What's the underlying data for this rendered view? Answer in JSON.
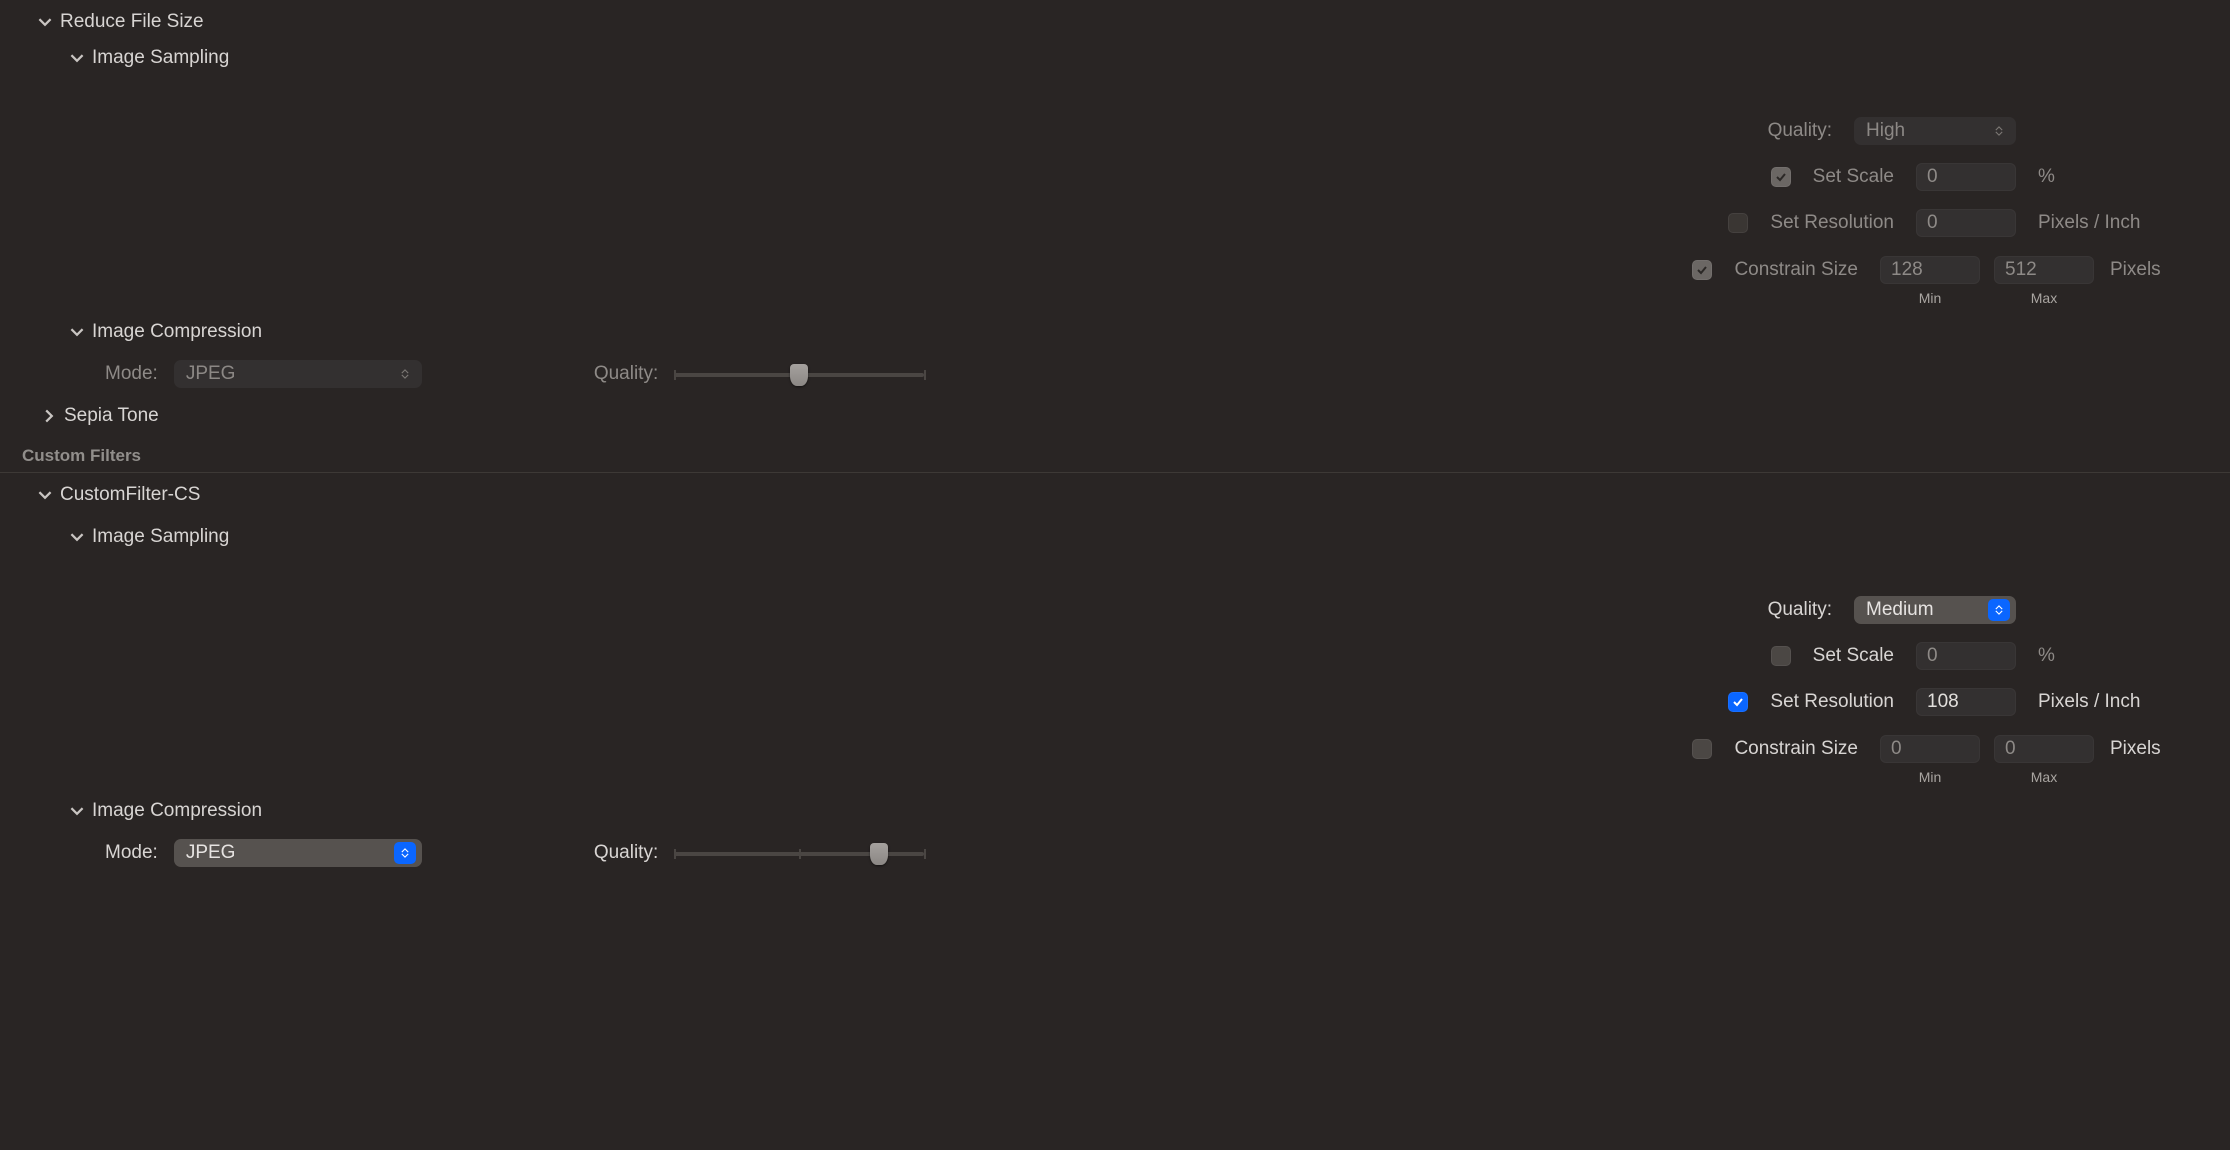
{
  "labels": {
    "quality": "Quality:",
    "set_scale": "Set Scale",
    "set_resolution": "Set Resolution",
    "constrain_size": "Constrain Size",
    "percent": "%",
    "ppi": "Pixels / Inch",
    "pixels": "Pixels",
    "min": "Min",
    "max": "Max",
    "mode": "Mode:",
    "custom_filters": "Custom Filters",
    "sepia_tone": "Sepia Tone",
    "image_sampling": "Image Sampling",
    "image_compression": "Image Compression",
    "reduce_file_size": "Reduce File Size",
    "custom_filter_cs": "CustomFilter-CS"
  },
  "filters": {
    "reduce": {
      "sampling": {
        "quality": "High",
        "scale": "0",
        "resolution": "0",
        "constrain_min": "128",
        "constrain_max": "512"
      },
      "compression": {
        "mode": "JPEG"
      }
    },
    "custom_cs": {
      "sampling": {
        "quality": "Medium",
        "scale": "0",
        "resolution": "108",
        "constrain_min": "0",
        "constrain_max": "0"
      },
      "compression": {
        "mode": "JPEG"
      }
    }
  }
}
